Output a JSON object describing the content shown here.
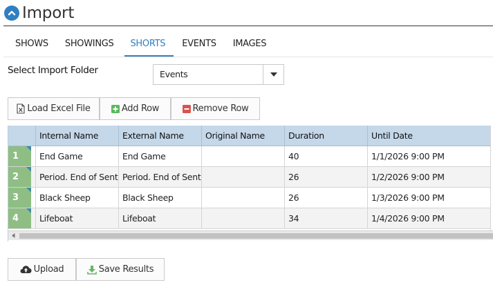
{
  "page": {
    "title": "Import"
  },
  "tabs": [
    {
      "label": "SHOWS",
      "active": false
    },
    {
      "label": "SHOWINGS",
      "active": false
    },
    {
      "label": "SHORTS",
      "active": true
    },
    {
      "label": "EVENTS",
      "active": false
    },
    {
      "label": "IMAGES",
      "active": false
    }
  ],
  "folder": {
    "label": "Select Import Folder",
    "value": "Events"
  },
  "toolbar": {
    "load_label": "Load Excel File",
    "add_label": "Add Row",
    "remove_label": "Remove Row"
  },
  "grid": {
    "columns": [
      "Internal Name",
      "External Name",
      "Original Name",
      "Duration",
      "Until Date"
    ],
    "rows": [
      {
        "num": "1",
        "cells": [
          "End Game",
          "End Game",
          "",
          "40",
          "1/1/2026 9:00 PM"
        ]
      },
      {
        "num": "2",
        "cells": [
          "Period. End of Sentence.",
          "Period. End of Sentence.",
          "",
          "26",
          "1/2/2026 9:00 PM"
        ]
      },
      {
        "num": "3",
        "cells": [
          "Black Sheep",
          "Black Sheep",
          "",
          "26",
          "1/3/2026 9:00 PM"
        ]
      },
      {
        "num": "4",
        "cells": [
          "Lifeboat",
          "Lifeboat",
          "",
          "34",
          "1/4/2026 9:00 PM"
        ]
      }
    ]
  },
  "footer": {
    "upload_label": "Upload",
    "save_label": "Save Results"
  },
  "colors": {
    "accent": "#2f7fc1",
    "grid_header": "#c5d8ea",
    "row_number": "#8fbe84",
    "add_icon": "#5cb85c",
    "remove_icon": "#d9534f",
    "save_icon": "#6bb36b"
  },
  "icons": {
    "title": "chevron-up-circle-icon",
    "folder_select": "caret-down-icon",
    "load": "excel-file-icon",
    "add": "plus-square-icon",
    "remove": "minus-square-icon",
    "upload": "cloud-upload-icon",
    "save": "download-icon"
  }
}
